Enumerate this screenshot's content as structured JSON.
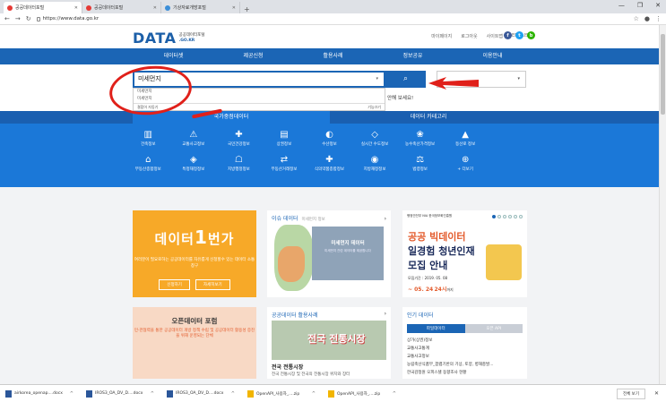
{
  "browser": {
    "tabs": [
      {
        "label": "공공데이터포털"
      },
      {
        "label": "공공데이터포털"
      },
      {
        "label": "기상자료개방포털"
      }
    ],
    "url": "https://www.data.go.kr"
  },
  "site": {
    "logo_main": "DATA",
    "logo_sub1": "공공데이터포털",
    "logo_sub2": ".GO.KR",
    "toplinks": [
      "마이페이지",
      "로그아웃",
      "사이트맵",
      "ENGLISH"
    ],
    "gnb": [
      "데이터셋",
      "제공신청",
      "활용사례",
      "정보공유",
      "이용안내"
    ]
  },
  "search": {
    "query": "미세먼지",
    "suggestions": [
      "미세먼지",
      "미세먼지"
    ],
    "suggest_footer_left": "결합어 자동기",
    "suggest_footer_right": "기능끄기",
    "hint": "안해 보세요!"
  },
  "categories": {
    "tab_on": "국가중점데이터",
    "tab_off": "데이터 카테고리",
    "items": [
      {
        "label": "건축정보",
        "icon": "building-icon"
      },
      {
        "label": "교통사고정보",
        "icon": "traffic-icon"
      },
      {
        "label": "국민건강정보",
        "icon": "health-icon"
      },
      {
        "label": "상권정보",
        "icon": "store-icon"
      },
      {
        "label": "수산정보",
        "icon": "fish-icon"
      },
      {
        "label": "실시간 수도정보",
        "icon": "water-icon"
      },
      {
        "label": "농수축산가격정보",
        "icon": "produce-icon"
      },
      {
        "label": "등산로 정보",
        "icon": "mountain-icon"
      },
      {
        "label": "",
        "icon": "blank"
      },
      {
        "label": "부동산종합정보",
        "icon": "realestate-icon"
      },
      {
        "label": "특정재정정보",
        "icon": "finance-icon"
      },
      {
        "label": "지방행정정보",
        "icon": "admin-icon"
      },
      {
        "label": "부동산거래정보",
        "icon": "deal-icon"
      },
      {
        "label": "식의약품종합정보",
        "icon": "medicine-icon"
      },
      {
        "label": "지방재정정보",
        "icon": "budget-icon"
      },
      {
        "label": "법령정보",
        "icon": "law-icon"
      },
      {
        "label": "+ 더보기",
        "icon": "plus-icon"
      },
      {
        "label": "",
        "icon": "blank"
      }
    ]
  },
  "cards": {
    "c1": {
      "title_a": "데이터",
      "title_b": "1",
      "title_c": "번가",
      "desc": "여러분이 필요로하는 공공데이터를 자유롭게 신청할수 있는 데이터 소통창구",
      "btn1": "신청하기",
      "btn2": "자세히보기"
    },
    "c2": {
      "head": "이슈 데이터",
      "head_sub": "미세먼지 정보",
      "panel_title": "미세먼지 데이터",
      "panel_sub": "미세먼지 관련 데이터를 제공합니다"
    },
    "c3": {
      "logo": "행정안전부 NIA 한국정보화진흥원",
      "line1": "공공 빅데이터",
      "line2": "일경험 청년인재",
      "line3": "모집 안내",
      "period_a": "모집기간 : 2019. 05. 08",
      "period_b": "~ 05. 24",
      "period_b2": "24시",
      "period_b3": "까지"
    },
    "c4": {
      "title": "오픈데이터 포럼",
      "sub": "민·관협력을 통한 공공데이터 개방 정책 수립 및 공공데이터 활용성 증진을 위해 운영되는 단체"
    },
    "c5": {
      "head": "공공데이터 활용사례",
      "img_text": "전국 전통시장",
      "caption": "전국 전통시장",
      "sub": "전국 전통시장 및 전국의 전통시장 위치와 장터"
    },
    "c6": {
      "head": "인기 데이터",
      "tab_on": "파일데이터",
      "tab_off": "오픈 API",
      "items": [
        "상가(상권)정보",
        "교통사고통계",
        "교통사고정보",
        "농림축산식품부_팜랩기반의 기상, 토양, 병해충발...",
        "한국감정원 오피스텔 동향조사 현황"
      ]
    }
  },
  "downloads": [
    "airkorea_openap....docx",
    "IROS3_OA_DV_D....docx",
    "IROS3_OA_DV_D....docx",
    "OpenAPI_사용자_....zip",
    "OpenAPI_사용자_....zip"
  ],
  "downloads_showall": "전체 보기",
  "colors": {
    "primary": "#1b65b5",
    "category_bg": "#1b78d8",
    "annotation_red": "#e0201a",
    "orange": "#f7a928"
  }
}
